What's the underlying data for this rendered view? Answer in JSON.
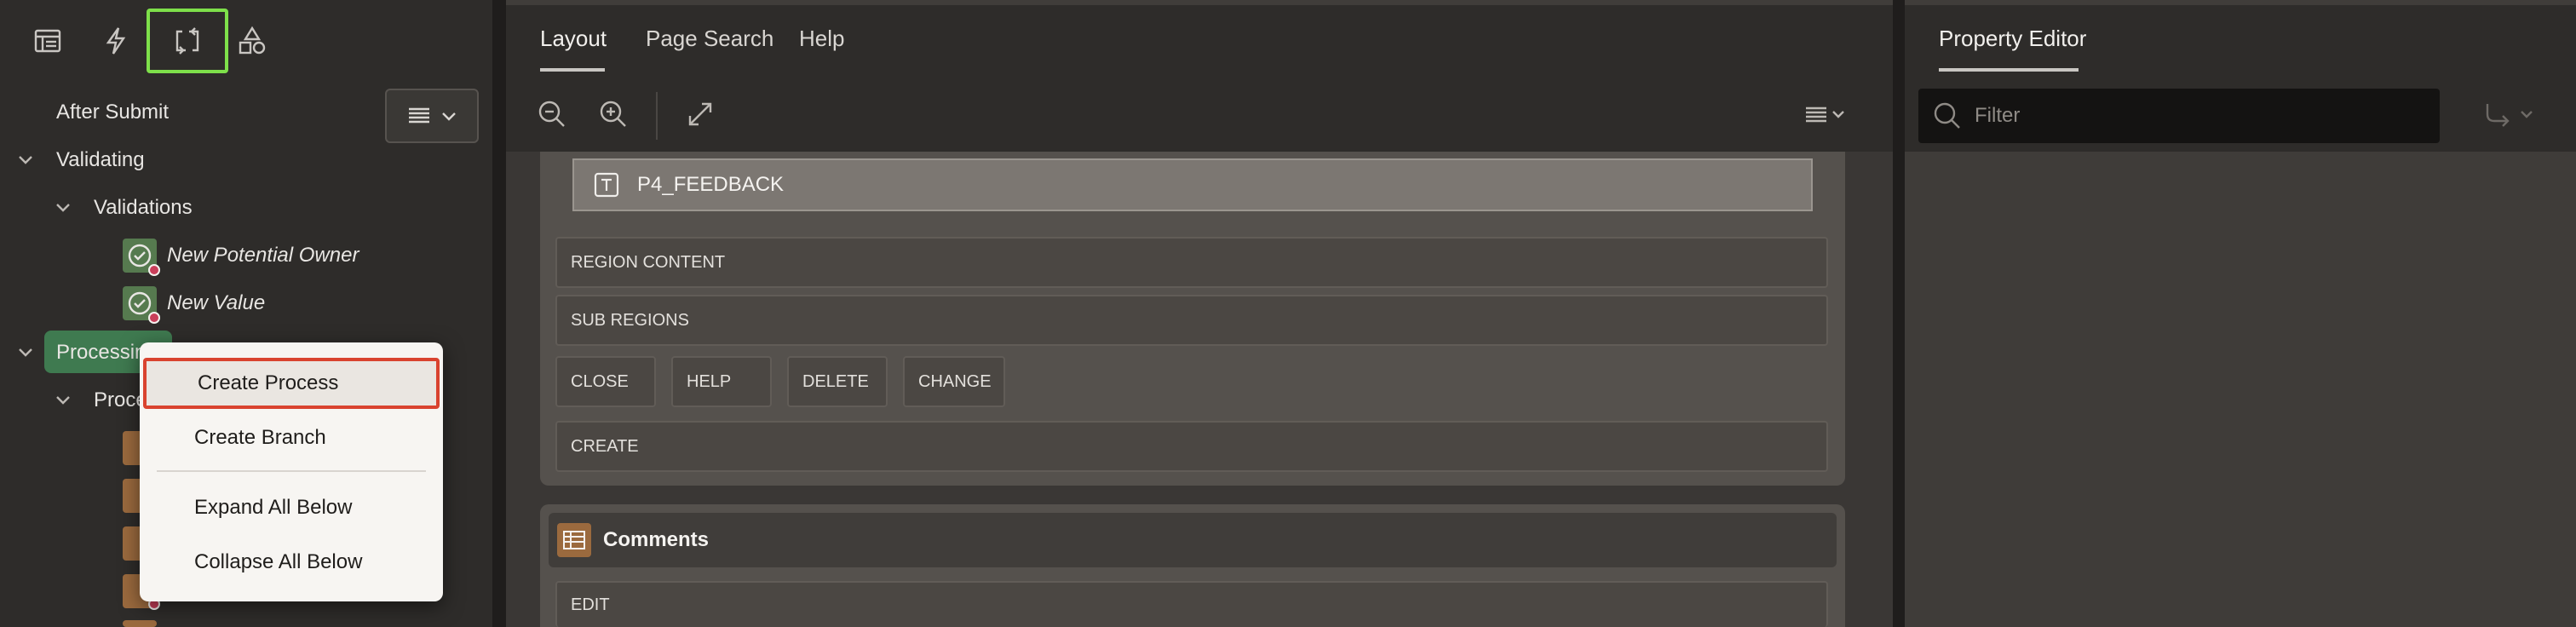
{
  "left_tabs": [
    "rendering-tab",
    "dynamic-actions-tab",
    "processing-tab",
    "shared-components-tab"
  ],
  "tree": {
    "after_submit": "After Submit",
    "validating": "Validating",
    "validations": "Validations",
    "validation_items": [
      "New Potential Owner",
      "New Value"
    ],
    "processing": "Processing",
    "processes_partial": "Proce"
  },
  "context_menu": {
    "items": [
      "Create Process",
      "Create Branch",
      "Expand All Below",
      "Collapse All Below"
    ]
  },
  "middle": {
    "tabs": [
      "Layout",
      "Page Search",
      "Help"
    ],
    "item_name": "P4_FEEDBACK",
    "slots": [
      "REGION CONTENT",
      "SUB REGIONS",
      "CLOSE",
      "HELP",
      "DELETE",
      "CHANGE",
      "CREATE",
      "EDIT"
    ],
    "region2_title": "Comments"
  },
  "right": {
    "title": "Property Editor",
    "filter_placeholder": "Filter"
  },
  "colors": {
    "highlight_tab": "#7ee04a",
    "selected_menu_border": "#d9432f",
    "processing_selected": "#3f7a50"
  }
}
